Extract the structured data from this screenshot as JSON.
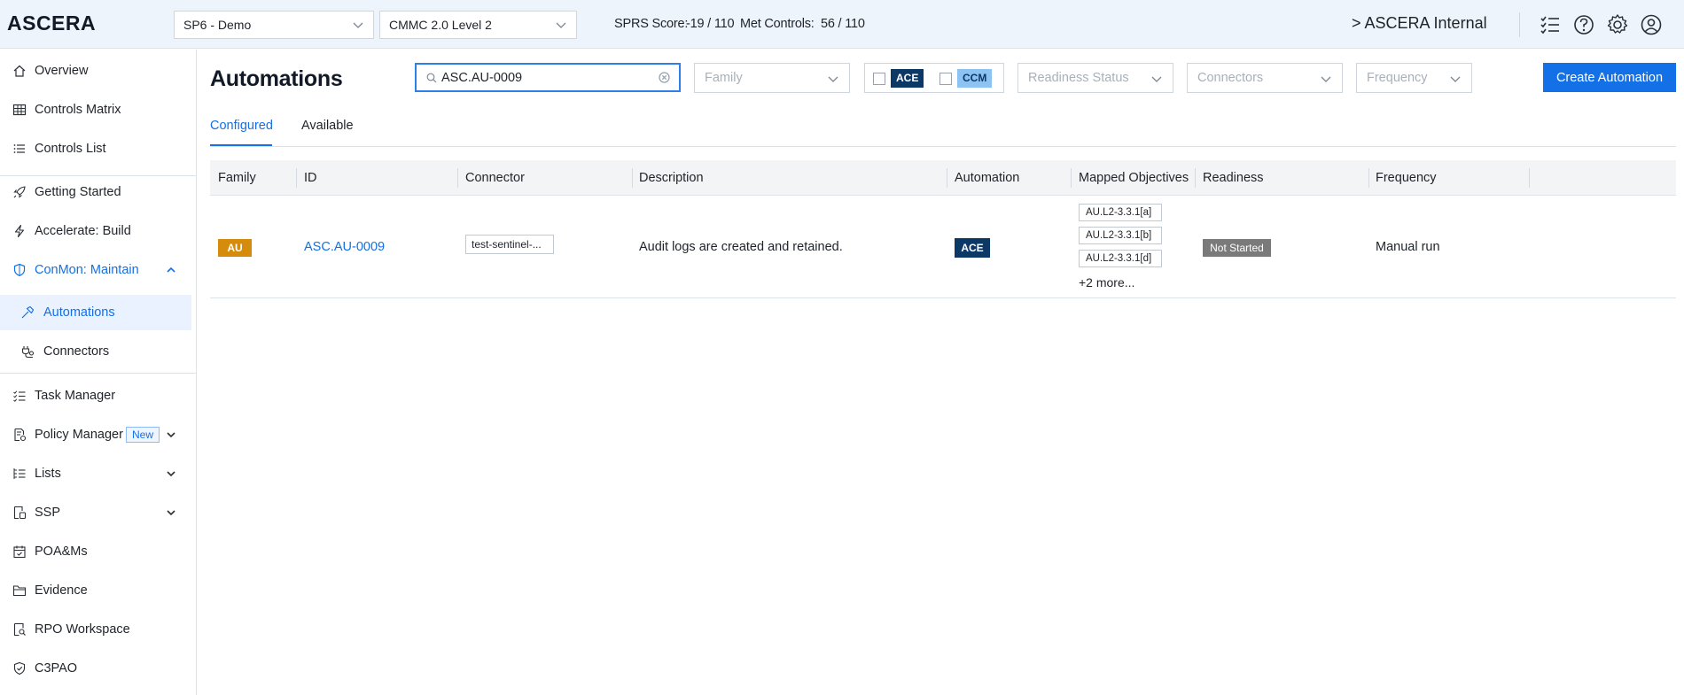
{
  "app": {
    "logo": "ASCERA"
  },
  "header": {
    "org_select": "SP6 - Demo",
    "framework_select": "CMMC 2.0 Level 2",
    "sprs_label": "SPRS Score:",
    "sprs_value": "-19 / 110",
    "met_label": "Met Controls:",
    "met_value": "56 / 110",
    "org_name": "> ASCERA Internal"
  },
  "sidebar": {
    "items": [
      {
        "label": "Overview",
        "icon": "home-icon"
      },
      {
        "label": "Controls Matrix",
        "icon": "grid-icon"
      },
      {
        "label": "Controls List",
        "icon": "list-icon"
      },
      {
        "label": "Getting Started",
        "icon": "rocket-icon"
      },
      {
        "label": "Accelerate: Build",
        "icon": "bolt-icon"
      },
      {
        "label": "ConMon: Maintain",
        "icon": "shield-icon"
      },
      {
        "label": "Automations",
        "icon": "hammer-icon"
      },
      {
        "label": "Connectors",
        "icon": "plug-icon"
      },
      {
        "label": "Task Manager",
        "icon": "checklist-icon"
      },
      {
        "label": "Policy Manager",
        "icon": "policy-icon",
        "badge": "New"
      },
      {
        "label": "Lists",
        "icon": "lists-icon"
      },
      {
        "label": "SSP",
        "icon": "ssp-icon"
      },
      {
        "label": "POA&Ms",
        "icon": "calendar-check-icon"
      },
      {
        "label": "Evidence",
        "icon": "folder-icon"
      },
      {
        "label": "RPO Workspace",
        "icon": "search-doc-icon"
      },
      {
        "label": "C3PAO",
        "icon": "shield-check-icon"
      }
    ]
  },
  "main": {
    "title": "Automations",
    "search": {
      "value": "ASC.AU-0009",
      "placeholder": "Search"
    },
    "filters": {
      "family": "Family",
      "readiness": "Readiness Status",
      "connectors": "Connectors",
      "frequency": "Frequency",
      "toggle_ace": "ACE",
      "toggle_ccm": "CCM"
    },
    "create_button": "Create Automation",
    "tabs": [
      "Configured",
      "Available"
    ],
    "table": {
      "columns": [
        "Family",
        "ID",
        "Connector",
        "Description",
        "Automation",
        "Mapped Objectives",
        "Readiness",
        "Frequency"
      ],
      "rows": [
        {
          "family": "AU",
          "id": "ASC.AU-0009",
          "connector": "test-sentinel-...",
          "description": "Audit logs are created and retained.",
          "automation": "ACE",
          "objectives": [
            "AU.L2-3.3.1[a]",
            "AU.L2-3.3.1[b]",
            "AU.L2-3.3.1[d]"
          ],
          "more": "+2 more...",
          "readiness": "Not Started",
          "frequency": "Manual run"
        }
      ]
    }
  },
  "colors": {
    "accent": "#1470e6",
    "family_au": "#d58b0b",
    "ace_badge": "#0c3866",
    "ccm_badge": "#8cc3f2",
    "readiness_not_started": "#7a7a7a",
    "header_bg": "#eef4fb"
  }
}
